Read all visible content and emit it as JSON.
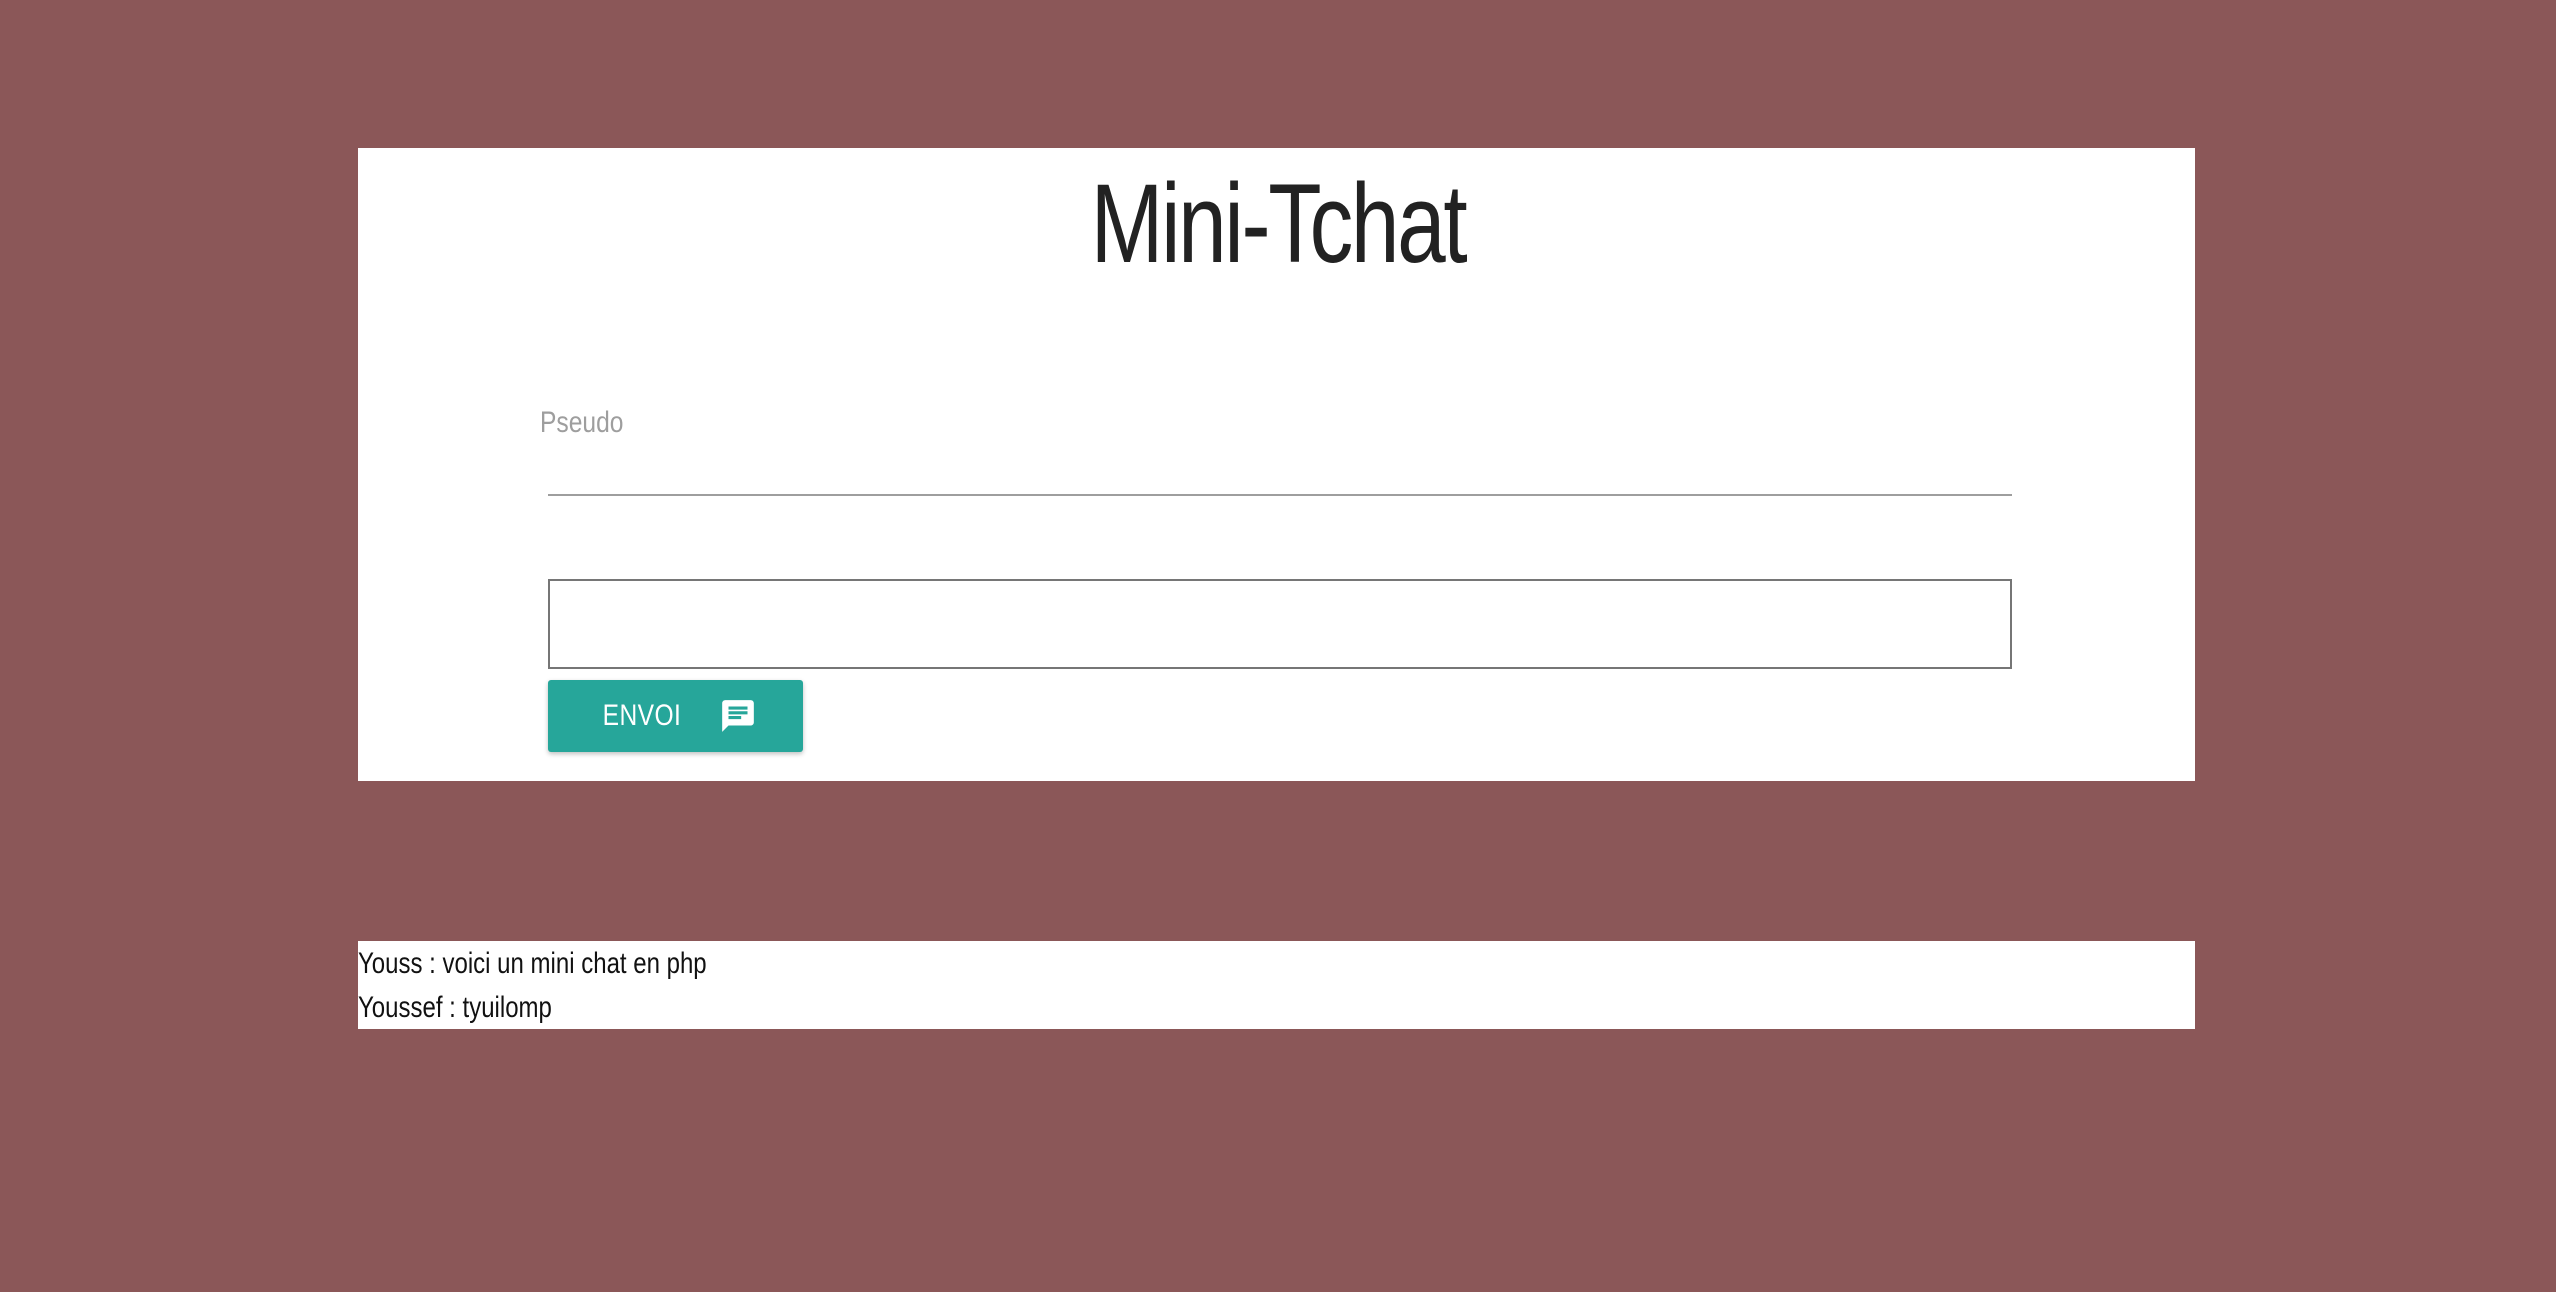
{
  "app": {
    "title": "Mini-Tchat"
  },
  "form": {
    "pseudo_label": "Pseudo",
    "pseudo_value": "",
    "message_value": "",
    "send_label": "ENVOI",
    "send_icon": "chat-message-icon"
  },
  "messages": [
    {
      "text": "Youss : voici un mini chat en php"
    },
    {
      "text": "Youssef : tyuilomp"
    }
  ],
  "colors": {
    "background": "#8b5758",
    "card": "#ffffff",
    "button": "#26a69a"
  }
}
